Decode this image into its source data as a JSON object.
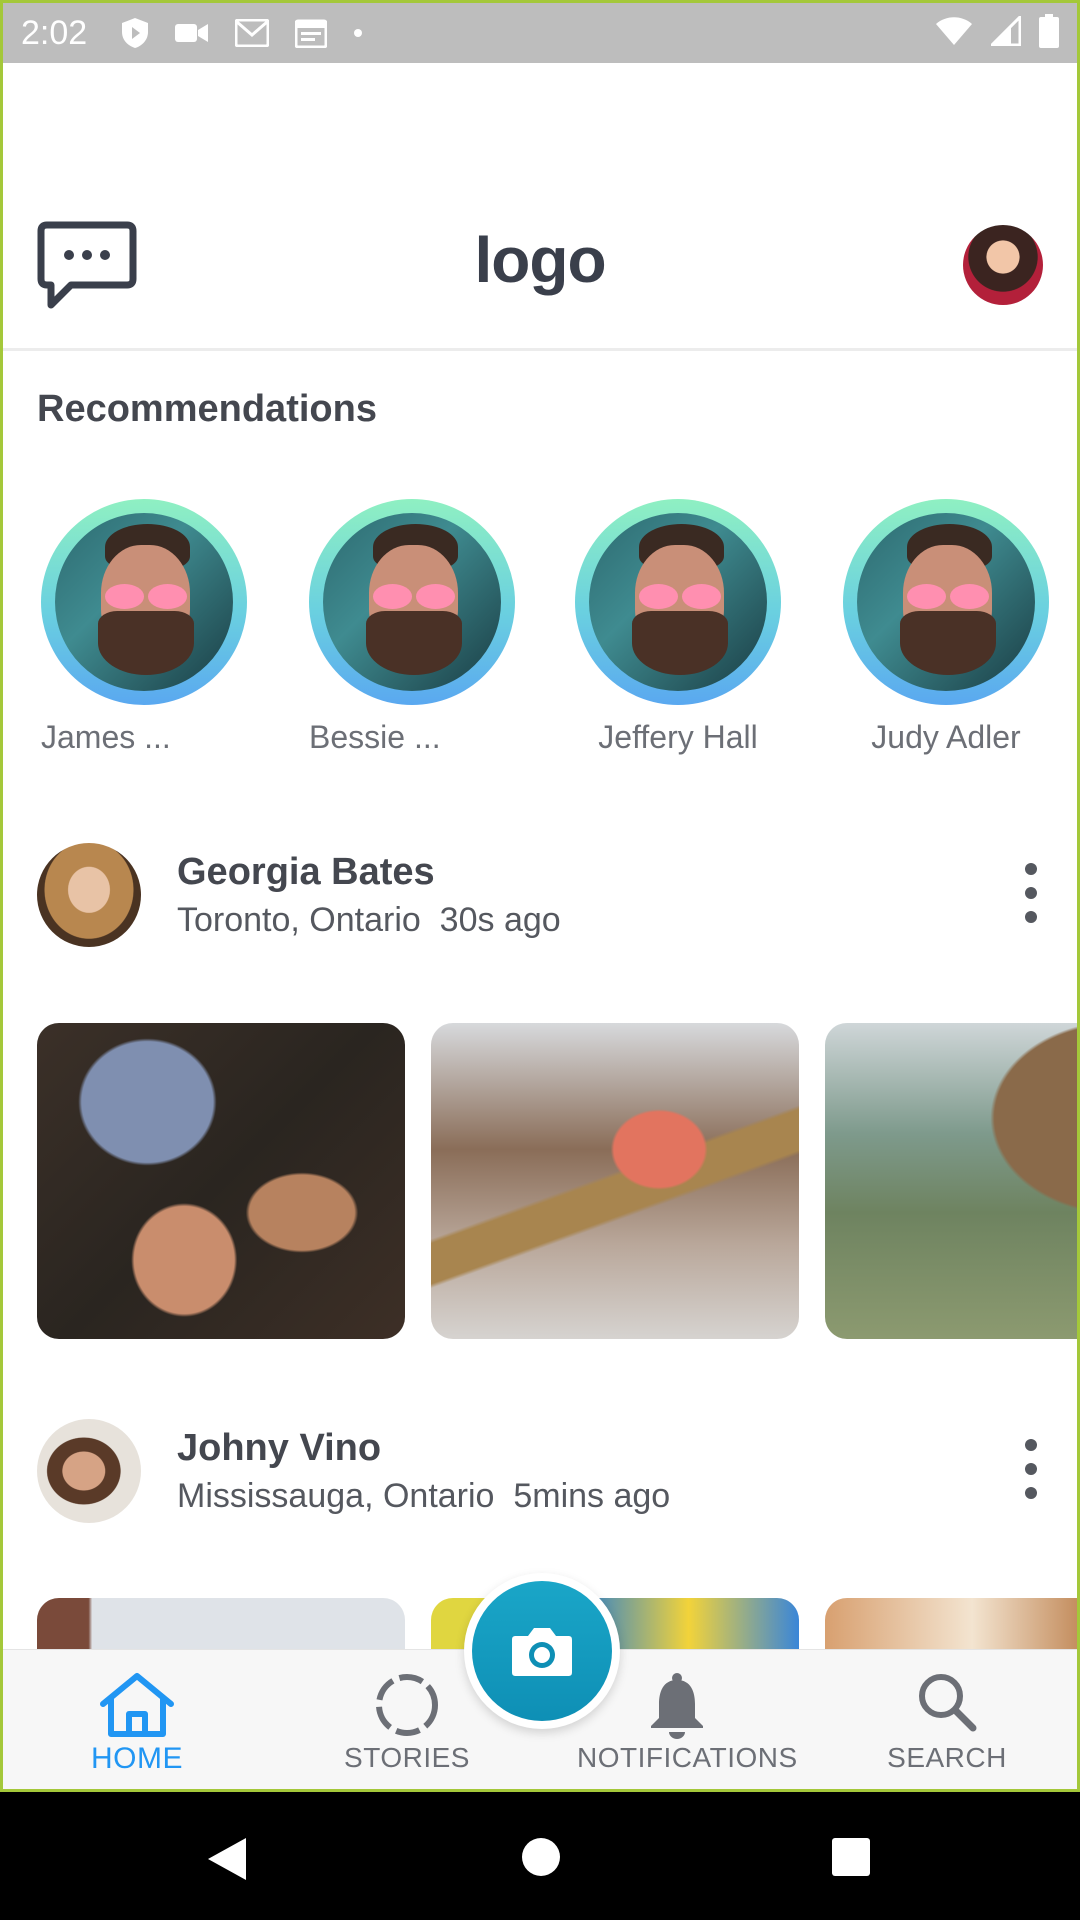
{
  "status_bar": {
    "time": "2:02",
    "icons": [
      "shield-icon",
      "video-camera-icon",
      "gmail-icon",
      "calendar-icon",
      "dot-icon"
    ],
    "right_icons": [
      "wifi-icon",
      "signal-icon",
      "battery-icon"
    ]
  },
  "header": {
    "logo": "logo",
    "chat_icon": "chat-bubble-icon",
    "profile_avatar": "avatar"
  },
  "recommendations": {
    "title": "Recommendations",
    "items": [
      {
        "name": "James ..."
      },
      {
        "name": "Bessie ..."
      },
      {
        "name": "Jeffery Hall"
      },
      {
        "name": "Judy Adler"
      }
    ]
  },
  "posts": [
    {
      "author": "Georgia Bates",
      "location": "Toronto, Ontario",
      "time": "30s ago",
      "meta": "Toronto, Ontario  30s ago"
    },
    {
      "author": "Johny Vino",
      "location": "Mississauga, Ontario",
      "time": "5mins ago",
      "meta": "Mississauga, Ontario  5mins ago"
    }
  ],
  "bottom_nav": {
    "items": [
      {
        "label": "HOME",
        "icon": "home-icon",
        "active": true
      },
      {
        "label": "STORIES",
        "icon": "stories-icon",
        "active": false
      },
      {
        "label": "NOTIFICATIONS",
        "icon": "bell-icon",
        "active": false
      },
      {
        "label": "SEARCH",
        "icon": "search-icon",
        "active": false
      }
    ],
    "camera_button": "camera-icon"
  },
  "colors": {
    "accent": "#2196f3",
    "fab": "#1aa6c8",
    "frame_border": "#a4c83a"
  }
}
